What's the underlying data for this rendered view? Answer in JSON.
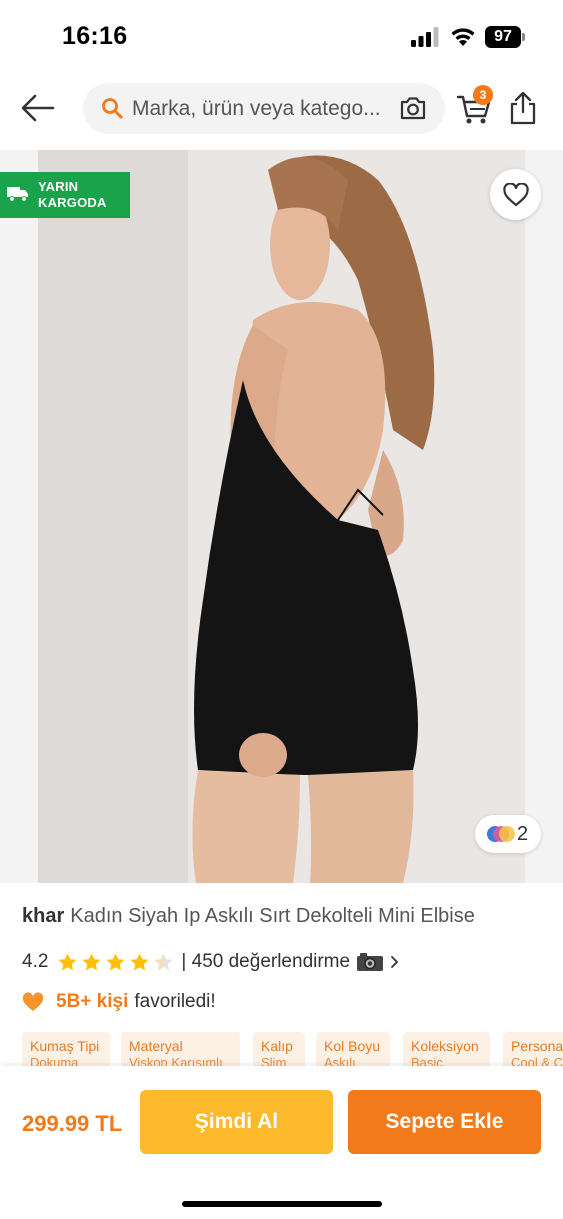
{
  "status_bar": {
    "time": "16:16",
    "battery": "97"
  },
  "nav": {
    "search_placeholder": "Marka, ürün veya katego...",
    "cart_count": "3"
  },
  "product": {
    "cargo_badge": {
      "line1": "YARIN",
      "line2": "KARGODA"
    },
    "variant_count": "2",
    "brand": "khar",
    "title": "Kadın Siyah Ip Askılı Sırt Dekolteli Mini Elbise",
    "rating": "4.2",
    "rating_stars": 4.2,
    "review_text": "| 450 değerlendirme",
    "favorite_count": "5B+ kişi",
    "favorite_suffix": "favoriledi!"
  },
  "attributes": [
    {
      "label": "Kumaş Tipi",
      "value": "Dokuma"
    },
    {
      "label": "Materyal",
      "value": "Viskon Karışımlı"
    },
    {
      "label": "Kalıp",
      "value": "Slim"
    },
    {
      "label": "Kol Boyu",
      "value": "Askılı"
    },
    {
      "label": "Koleksiyon",
      "value": "Basic"
    },
    {
      "label": "Persona",
      "value": "Cool & C"
    }
  ],
  "bottom": {
    "price": "299.99 TL",
    "buy_now": "Şimdi Al",
    "add_to_cart": "Sepete Ekle"
  },
  "colors": {
    "brand_orange": "#f27a1a",
    "buy_yellow": "#fbb92b",
    "cargo_green": "#1aa34a"
  }
}
